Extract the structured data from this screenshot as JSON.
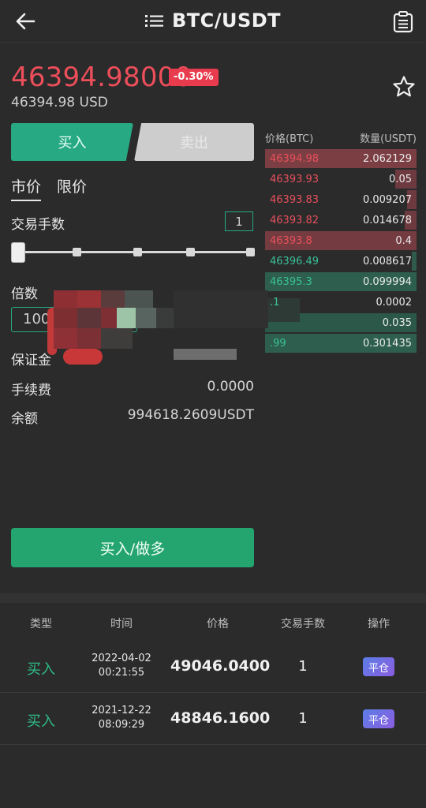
{
  "header": {
    "title": "BTC/USDT",
    "back_icon": "arrow-left-icon",
    "menu_icon": "list-icon",
    "doc_icon": "clipboard-icon"
  },
  "ticker": {
    "price": "46394.98000",
    "change": "-0.30%",
    "usd_price": "46394.98 USD",
    "change_color": "#e83b4d",
    "price_color": "#ec4e5a"
  },
  "trade": {
    "buy_tab": "买入",
    "sell_tab": "卖出",
    "order_types": [
      "市价",
      "限价"
    ],
    "qty_label": "交易手数",
    "qty_value": "1",
    "slider_level": 0,
    "leverage_label": "倍数",
    "leverage_value": "100",
    "margin_label": "保证金",
    "fee_label": "手续费",
    "fee_value": "0.0000",
    "balance_label": "余额",
    "balance_value": "994618.2609USDT",
    "submit_label": "买入/做多",
    "accent_color": "#27a983"
  },
  "orderbook": {
    "price_header": "价格(BTC)",
    "amount_header": "数量(USDT)",
    "asks": [
      {
        "price": "46394.98",
        "amount": "2.062129"
      },
      {
        "price": "46393.93",
        "amount": "0.05"
      },
      {
        "price": "46393.83",
        "amount": "0.009207"
      },
      {
        "price": "46393.82",
        "amount": "0.014678"
      },
      {
        "price": "46393.8",
        "amount": "0.4"
      }
    ],
    "bids": [
      {
        "price": "46396.49",
        "amount": "0.008617"
      },
      {
        "price": "46395.3",
        "amount": "0.099994"
      },
      {
        "price": ".1",
        "amount": "0.0002"
      },
      {
        "price": "",
        "amount": "0.035"
      },
      {
        "price": ".99",
        "amount": "0.301435"
      }
    ]
  },
  "orders": {
    "headers": [
      "类型",
      "时间",
      "价格",
      "交易手数",
      "操作"
    ],
    "rows": [
      {
        "type": "买入",
        "date": "2022-04-02",
        "time": "00:21:55",
        "price": "49046.0400",
        "qty": "1",
        "action": "平仓"
      },
      {
        "type": "买入",
        "date": "2021-12-22",
        "time": "08:09:29",
        "price": "48846.1600",
        "qty": "1",
        "action": "平仓"
      }
    ]
  }
}
